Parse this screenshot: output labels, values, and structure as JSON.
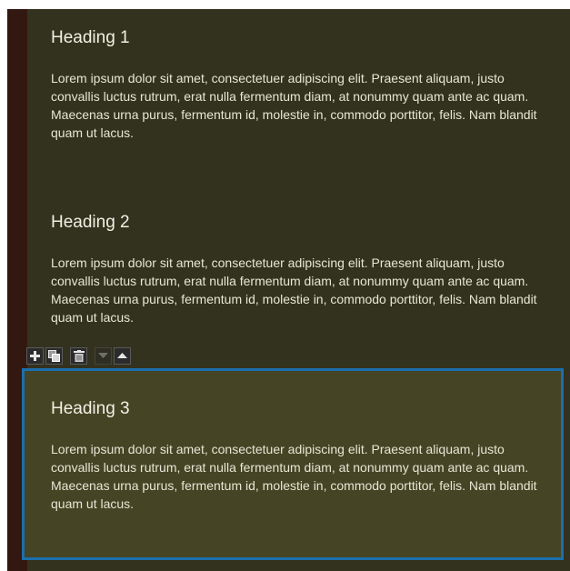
{
  "sections": [
    {
      "heading": "Heading 1",
      "body": "Lorem ipsum dolor sit amet, consectetuer adipiscing elit. Praesent aliquam, justo convallis luctus rutrum, erat nulla fermentum diam, at nonummy quam ante ac quam. Maecenas urna purus, fermentum id, molestie in, commodo porttitor, felis. Nam blandit quam ut lacus."
    },
    {
      "heading": "Heading 2",
      "body": "Lorem ipsum dolor sit amet, consectetuer adipiscing elit. Praesent aliquam, justo convallis luctus rutrum, erat nulla fermentum diam, at nonummy quam ante ac quam. Maecenas urna purus, fermentum id, molestie in, commodo porttitor, felis. Nam blandit quam ut lacus."
    },
    {
      "heading": "Heading 3",
      "body": "Lorem ipsum dolor sit amet, consectetuer adipiscing elit. Praesent aliquam, justo convallis luctus rutrum, erat nulla fermentum diam, at nonummy quam ante ac quam. Maecenas urna purus, fermentum id, molestie in, commodo porttitor, felis. Nam blandit quam ut lacus."
    }
  ],
  "toolbar": {
    "buttons": [
      {
        "icon": "plus-icon",
        "enabled": true
      },
      {
        "icon": "duplicate-icon",
        "enabled": true
      },
      {
        "icon": "trash-icon",
        "enabled": true
      },
      {
        "icon": "move-down-icon",
        "enabled": false
      },
      {
        "icon": "move-up-icon",
        "enabled": true
      }
    ]
  },
  "colors": {
    "panel_background": "#33321f",
    "selected_background": "#454425",
    "selection_border": "#1b6fad",
    "left_strip": "#331811",
    "text": "#e8e6d5"
  }
}
